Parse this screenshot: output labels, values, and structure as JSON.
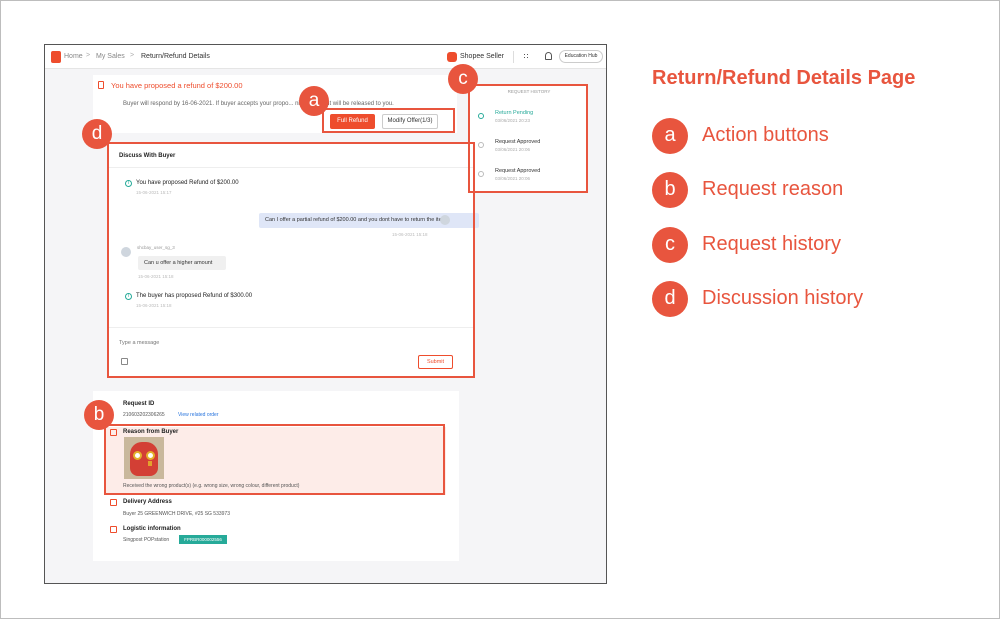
{
  "page_title": "Return/Refund Details Page",
  "legend": [
    {
      "marker": "a",
      "label": "Action buttons"
    },
    {
      "marker": "b",
      "label": "Request reason"
    },
    {
      "marker": "c",
      "label": "Request history"
    },
    {
      "marker": "d",
      "label": "Discussion history"
    }
  ],
  "topbar": {
    "breadcrumb_home": "Home",
    "breadcrumb_sales": "My Sales",
    "breadcrumb_current": "Return/Refund Details",
    "seller_name": "Shopee Seller",
    "education_hub": "Education Hub",
    "sep": ">"
  },
  "banner": {
    "title": "You have proposed a refund of $200.00",
    "subtitle": "Buyer will respond by 16-06-2021. If buyer accepts your propo... ning payment will be released to you.",
    "full_refund_label": "Full Refund",
    "modify_offer_label": "Modify Offer(1/3)"
  },
  "history": {
    "title": "REQUEST HISTORY",
    "items": [
      {
        "label": "Return Pending",
        "time": "03/06/2021 20:23"
      },
      {
        "label": "Request Approved",
        "time": "03/06/2021 20:06"
      },
      {
        "label": "Request Approved",
        "time": "03/06/2021 20:06"
      }
    ]
  },
  "discussion": {
    "title": "Discuss With Buyer",
    "msg1": "You have proposed Refund of $200.00",
    "msg1_time": "15-06-2021 15:17",
    "seller_msg": "Can I offer a partial refund of $200.00 and you dont have to return the item",
    "seller_msg_time": "15-06-2021 15:18",
    "buyer_name": "shcbay_user_sg_3",
    "buyer_msg": "Can u offer a higher amount",
    "buyer_msg_time": "15-06-2021 15:18",
    "msg2": "The buyer has proposed Refund of $300.00",
    "msg2_time": "15-06-2021 15:18",
    "input_placeholder": "Type a message",
    "submit_label": "Submit"
  },
  "details": {
    "request_id_label": "Request ID",
    "request_id": "210603202306265",
    "view_order_link": "View related order",
    "reason_label": "Reason from Buyer",
    "reason_text": "Received the wrong product(s) (e.g. wrong size, wrong colour, different product)",
    "delivery_label": "Delivery Address",
    "delivery_text": "Buyer 25 GREENWICH DRIVE, #25 SG 533973",
    "logistic_label": "Logistic information",
    "logistic_text": "Singpost POPstation",
    "tracking_no": "FPRBR000002556"
  },
  "markers": {
    "a": "a",
    "b": "b",
    "c": "c",
    "d": "d"
  },
  "colors": {
    "accent": "#e8553e",
    "shopee": "#ee4d2d",
    "teal": "#26aa99"
  }
}
